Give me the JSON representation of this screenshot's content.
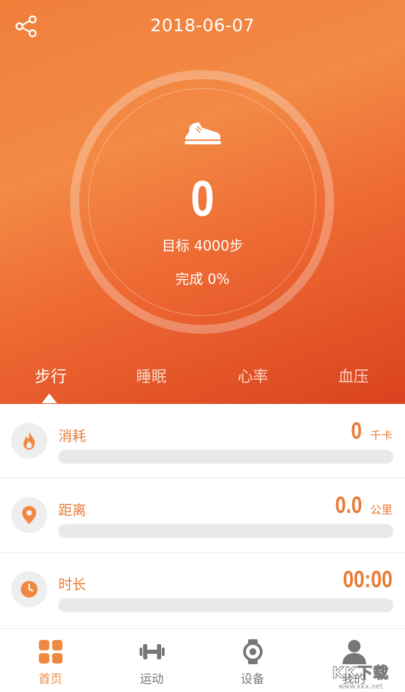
{
  "header": {
    "date": "2018-06-07"
  },
  "summary": {
    "steps": "0",
    "goal": "目标 4000步",
    "complete": "完成 0%"
  },
  "tabs": [
    {
      "label": "步行",
      "active": true
    },
    {
      "label": "睡眠",
      "active": false
    },
    {
      "label": "心率",
      "active": false
    },
    {
      "label": "血压",
      "active": false
    }
  ],
  "stats": [
    {
      "label": "消耗",
      "value": "0",
      "unit": "千卡",
      "icon": "flame-icon",
      "progress": 0
    },
    {
      "label": "距离",
      "value": "0.0",
      "unit": "公里",
      "icon": "location-pin-icon",
      "progress": 0
    },
    {
      "label": "时长",
      "value": "00:00",
      "unit": "",
      "icon": "clock-icon",
      "progress": 0
    }
  ],
  "nav": [
    {
      "label": "首页",
      "icon": "home-grid-icon",
      "active": true
    },
    {
      "label": "运动",
      "icon": "dumbbell-icon",
      "active": false
    },
    {
      "label": "设备",
      "icon": "watch-icon",
      "active": false
    },
    {
      "label": "我的",
      "icon": "user-icon",
      "active": false
    }
  ],
  "watermark": {
    "text": "KK下载",
    "url": "www.kkx.net"
  },
  "colors": {
    "accent": "#e87c36",
    "hero_top": "#f07f3a",
    "hero_bottom": "#d9421f"
  }
}
